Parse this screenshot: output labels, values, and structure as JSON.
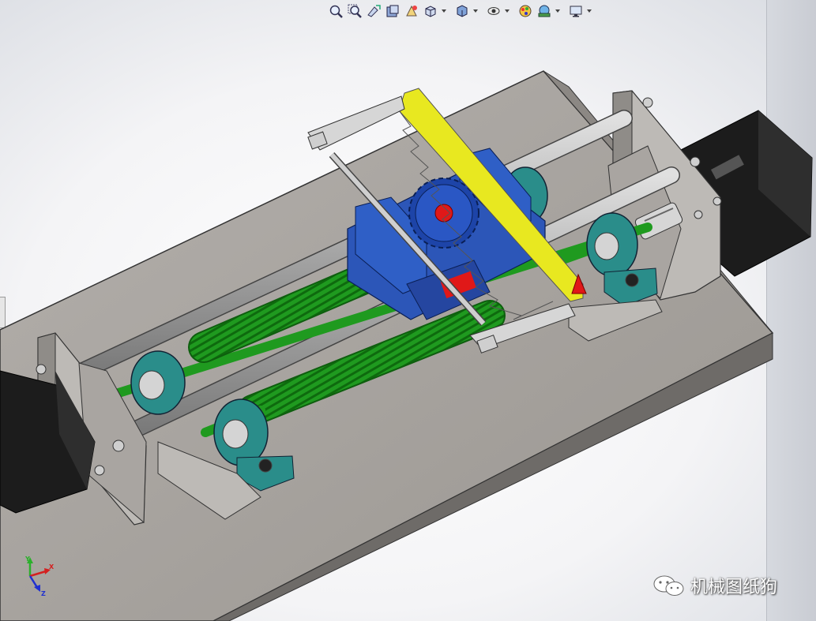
{
  "toolbar": {
    "buttons": [
      {
        "icon": "zoom-to-fit-icon",
        "caret": false
      },
      {
        "icon": "zoom-to-area-icon",
        "caret": false
      },
      {
        "icon": "previous-view-icon",
        "caret": false
      },
      {
        "icon": "section-view-icon",
        "caret": false
      },
      {
        "icon": "dynamic-annotation-icon",
        "caret": false
      },
      {
        "icon": "view-orientation-icon",
        "caret": true
      },
      {
        "icon": "display-style-icon",
        "caret": true
      },
      {
        "icon": "hide-show-items-icon",
        "caret": true
      },
      {
        "icon": "edit-appearance-icon",
        "caret": false
      },
      {
        "icon": "apply-scene-icon",
        "caret": true
      },
      {
        "icon": "view-settings-icon",
        "caret": true
      }
    ]
  },
  "triad": {
    "x": "X",
    "y": "Y",
    "z": "Z"
  },
  "watermark": {
    "text": "机械图纸狗"
  },
  "colors": {
    "base_plate": "#a8a4a0",
    "rack": "#e8e820",
    "carriage": "#2c56b8",
    "lead_screw": "#1f9a1f",
    "bearing": "#2a8d8a",
    "motor": "#1a1a1a",
    "rail": "#b8b8b8",
    "marker": "#e01818"
  }
}
